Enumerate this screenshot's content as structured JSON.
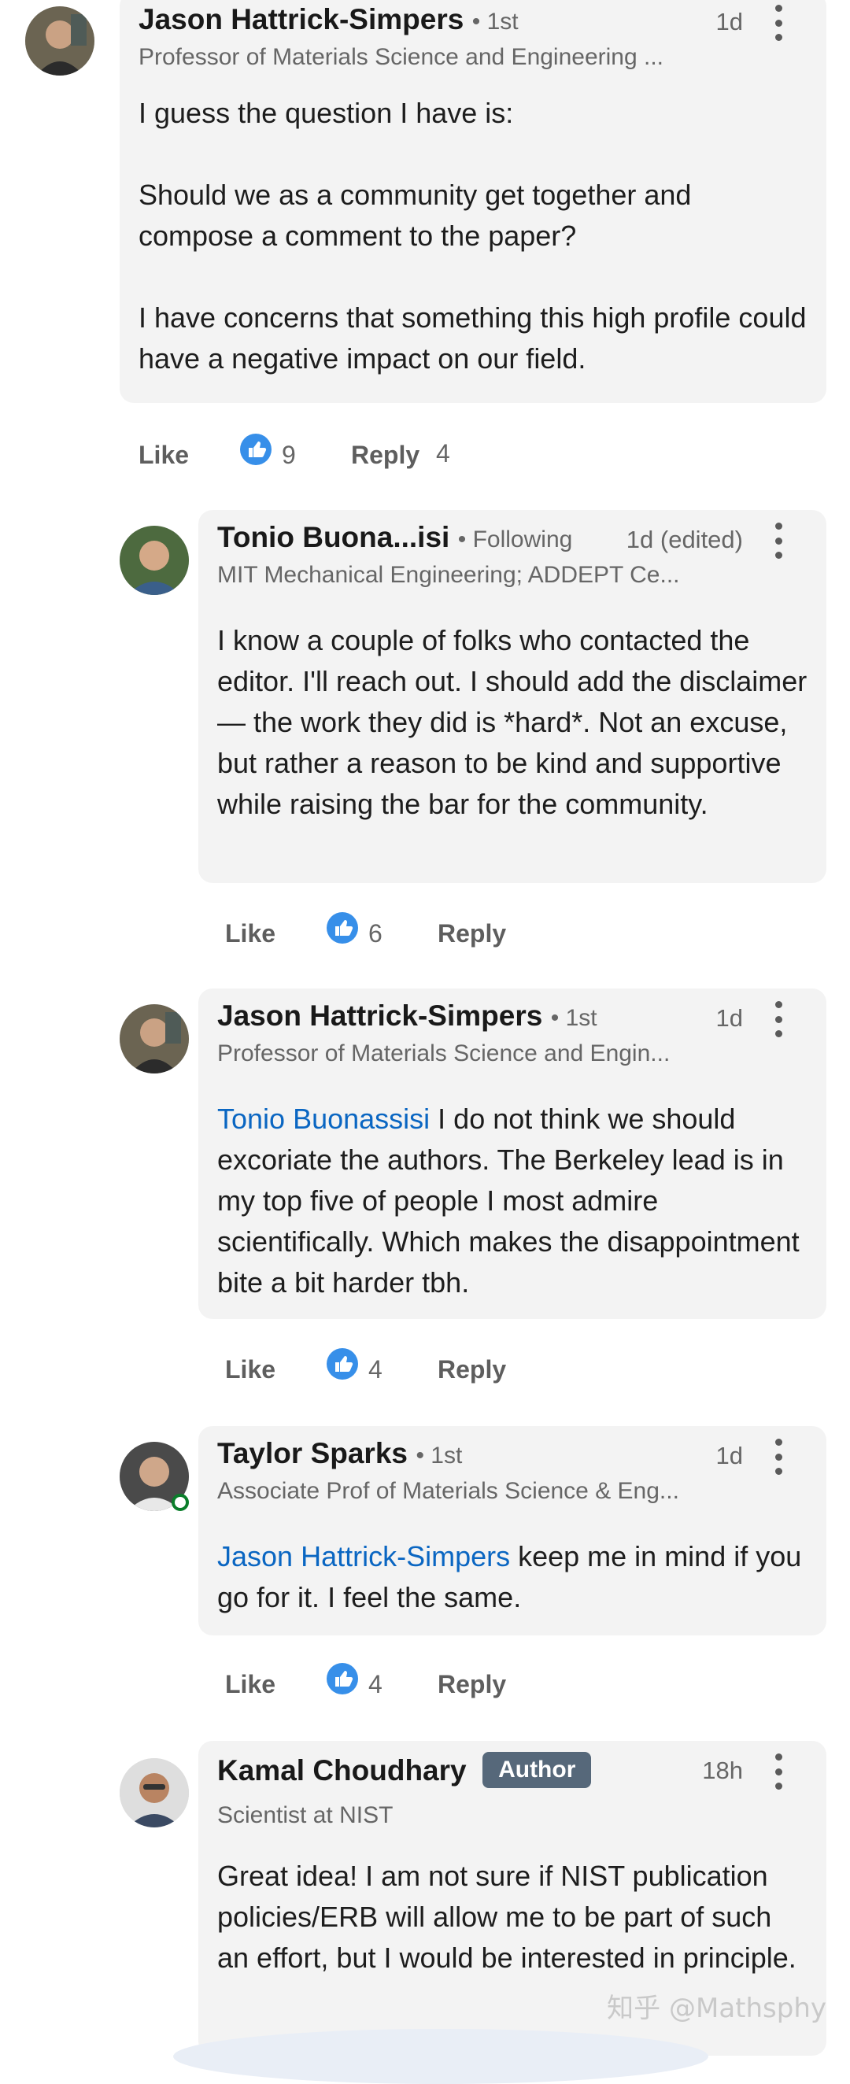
{
  "comments": [
    {
      "name": "Jason Hattrick-Simpers",
      "degree": "• 1st",
      "time": "1d",
      "headline": "Professor of Materials Science and Engineering ...",
      "body": "I guess the question I have is:\n\nShould we as a community get together and compose a comment to the paper?\n\nI have concerns that something this high profile could have a negative impact on our field.",
      "like_label": "Like",
      "reactions": "9",
      "reply_label": "Reply",
      "reply_count": "4"
    },
    {
      "name": "Tonio Buona...isi",
      "degree": "• Following",
      "time": "1d (edited)",
      "headline": "MIT Mechanical Engineering; ADDEPT Ce...",
      "body": "I know a couple of folks who contacted the editor. I'll reach out. I should add the disclaimer — the work they did is *hard*. Not an excuse, but rather a reason to be kind and supportive while raising the bar for the community.",
      "like_label": "Like",
      "reactions": "6",
      "reply_label": "Reply"
    },
    {
      "name": "Jason Hattrick-Simpers",
      "degree": "• 1st",
      "time": "1d",
      "headline": "Professor of Materials Science and Engin...",
      "mention": "Tonio Buonassisi",
      "body": " I do not think we should excoriate the authors. The Berkeley lead is in my top five of people I most admire scientifically. Which makes the disappointment bite a bit harder tbh.",
      "like_label": "Like",
      "reactions": "4",
      "reply_label": "Reply"
    },
    {
      "name": "Taylor Sparks",
      "degree": "• 1st",
      "time": "1d",
      "headline": "Associate Prof of Materials Science & Eng...",
      "mention": "Jason Hattrick-Simpers",
      "body": " keep me in mind if you go for it. I feel the same.",
      "like_label": "Like",
      "reactions": "4",
      "reply_label": "Reply"
    },
    {
      "name": "Kamal Choudhary",
      "badge": "Author",
      "time": "18h",
      "headline": "Scientist at NIST",
      "body": "Great idea! I am not sure if NIST publication policies/ERB will allow me to be part of such an effort, but I would be interested in principle."
    }
  ],
  "watermark": "知乎 @Mathsphy",
  "colors": {
    "mention": "#0a66c2",
    "bubble": "#f3f3f3",
    "badge": "#56687a",
    "reaction": "#378fe9"
  }
}
